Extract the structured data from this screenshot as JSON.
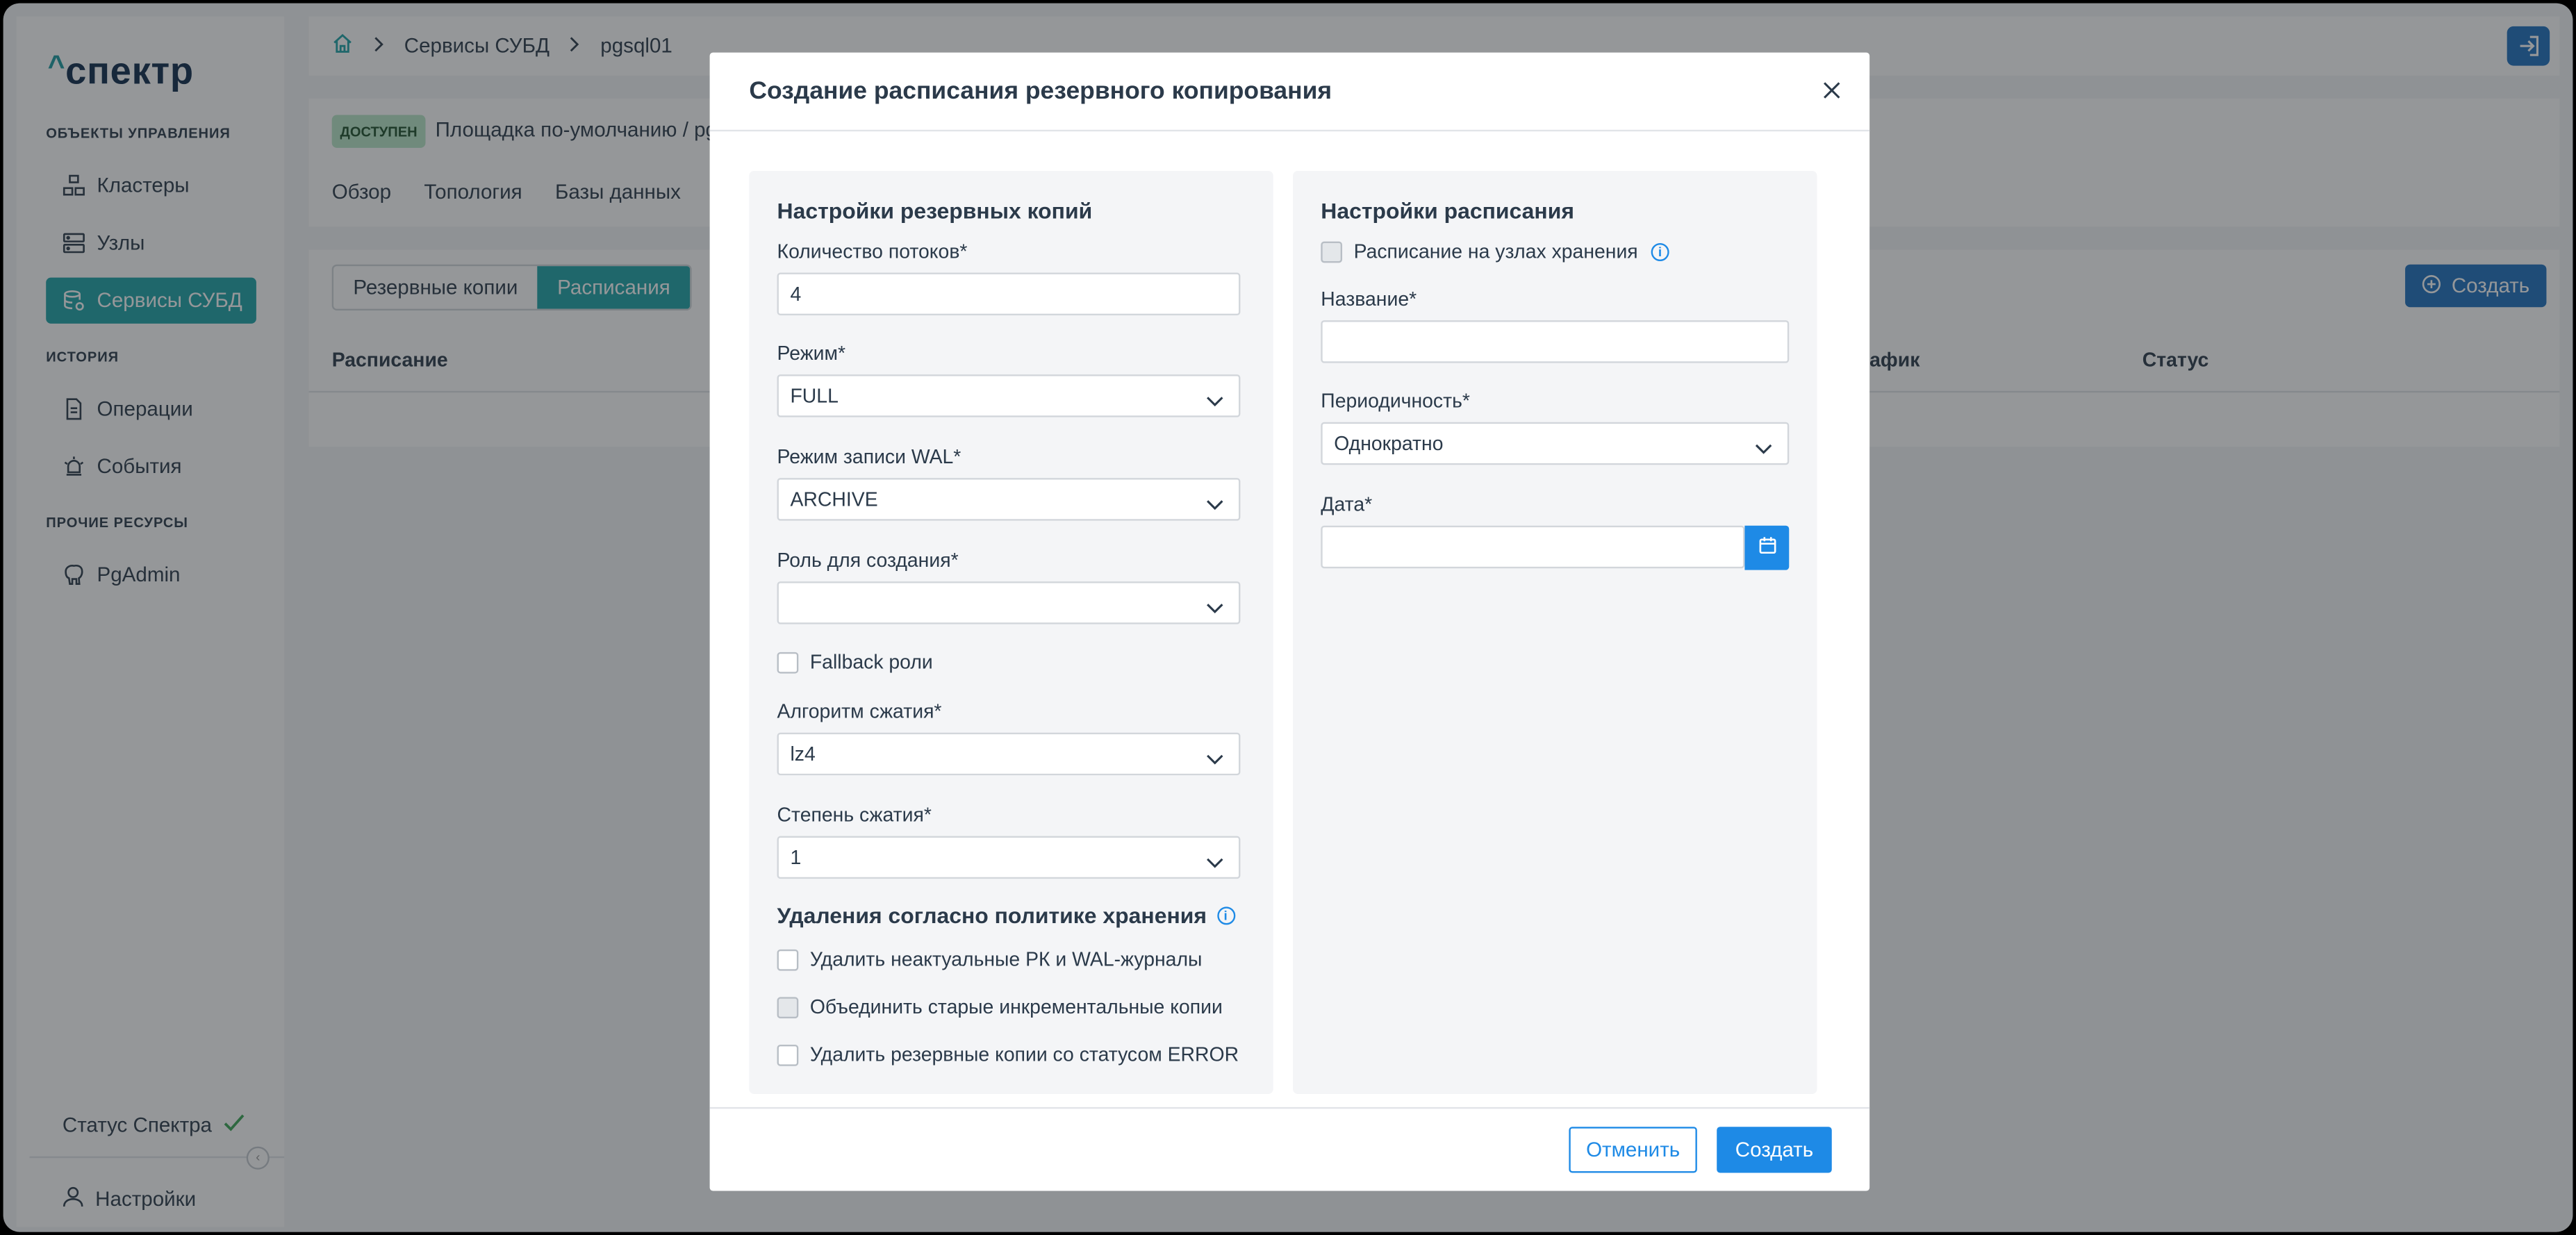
{
  "app": {
    "logo": "спектр",
    "sections": {
      "management": "ОБЪЕКТЫ УПРАВЛЕНИЯ",
      "history": "ИСТОРИЯ",
      "other": "ПРОЧИЕ РЕСУРСЫ"
    },
    "nav": {
      "clusters": "Кластеры",
      "nodes": "Узлы",
      "dbms": "Сервисы СУБД",
      "operations": "Операции",
      "events": "События",
      "pgadmin": "PgAdmin"
    },
    "status": "Статус Спектра",
    "settings": "Настройки"
  },
  "breadcrumb": {
    "item1": "Сервисы СУБД",
    "item2": "pgsql01"
  },
  "header": {
    "badge": "ДОСТУПЕН",
    "place": "Площадка по-умолчанию / pg",
    "tabs": {
      "overview": "Обзор",
      "topology": "Топология",
      "databases": "Базы данных"
    }
  },
  "content": {
    "seg_backups": "Резервные копии",
    "seg_schedules": "Расписания",
    "create": "Создать",
    "columns": {
      "schedule": "Расписание",
      "graph": "афик",
      "status": "Статус"
    }
  },
  "modal": {
    "title": "Создание расписания резервного копирования",
    "left": {
      "title": "Настройки резервных копий",
      "threads_label": "Количество потоков*",
      "threads_value": "4",
      "mode_label": "Режим*",
      "mode_value": "FULL",
      "wal_label": "Режим записи WAL*",
      "wal_value": "ARCHIVE",
      "role_label": "Роль для создания*",
      "role_value": "",
      "fallback": "Fallback роли",
      "algo_label": "Алгоритм сжатия*",
      "algo_value": "lz4",
      "level_label": "Степень сжатия*",
      "level_value": "1",
      "retention_title": "Удаления согласно политике хранения",
      "cb_delete": "Удалить неактуальные РК и WAL-журналы",
      "cb_merge": "Объединить старые инкрементальные копии",
      "cb_error": "Удалить резервные копии со статусом ERROR"
    },
    "right": {
      "title": "Настройки расписания",
      "storage_cb": "Расписание на узлах хранения",
      "name_label": "Название*",
      "name_value": "",
      "period_label": "Периодичность*",
      "period_value": "Однократно",
      "date_label": "Дата*",
      "date_value": ""
    },
    "cancel": "Отменить",
    "submit": "Создать"
  },
  "colors": {
    "teal": "#1ea3a7",
    "blue": "#1e8ae6",
    "navy": "#0f2b4c"
  }
}
